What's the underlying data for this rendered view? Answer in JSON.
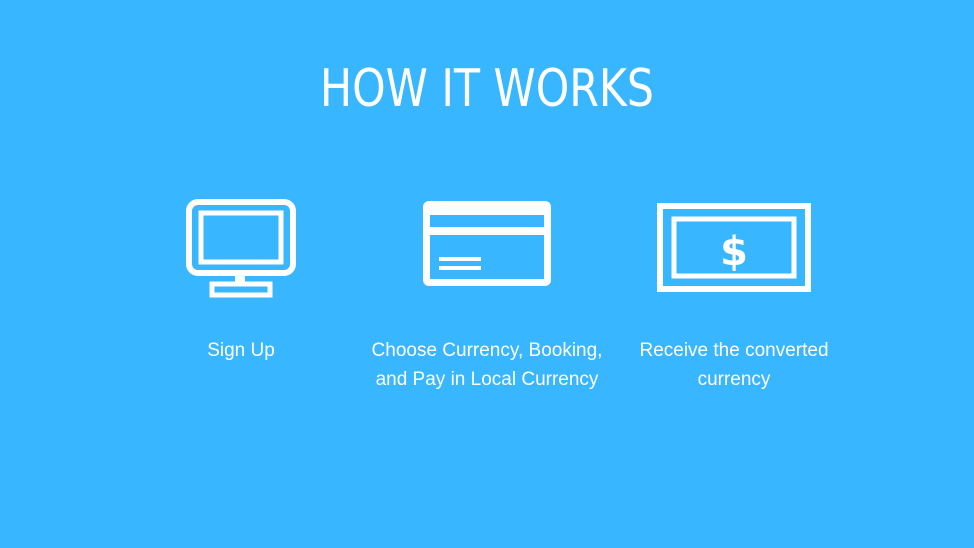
{
  "title": "HOW IT WORKS",
  "colors": {
    "background": "#38B6FF",
    "foreground": "#FFFFFF"
  },
  "steps": [
    {
      "icon": "monitor-icon",
      "label": "Sign Up"
    },
    {
      "icon": "credit-card-icon",
      "label": "Choose Currency, Booking, and Pay in Local Currency"
    },
    {
      "icon": "dollar-bill-icon",
      "label": "Receive the converted currency"
    }
  ]
}
